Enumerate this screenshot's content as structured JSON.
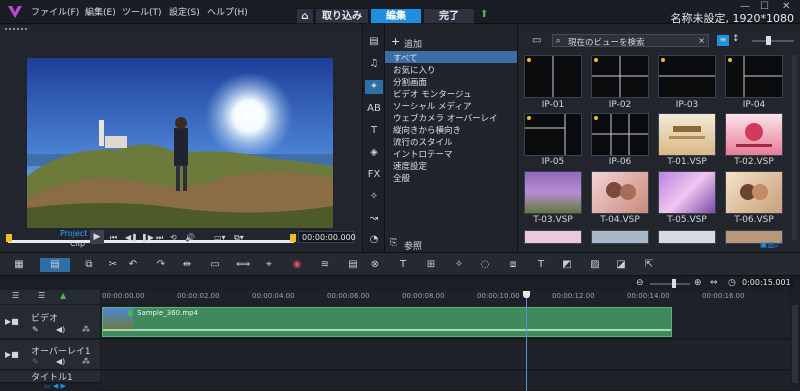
{
  "menu": [
    "ファイル(F)",
    "編集(E)",
    "ツール(T)",
    "設定(S)",
    "ヘルプ(H)"
  ],
  "nav_tabs": [
    {
      "label": "取り込み"
    },
    {
      "label": "編集",
      "active": true
    },
    {
      "label": "完了"
    }
  ],
  "project_title": "名称未設定, 1920*1080",
  "player": {
    "project_label": "Project",
    "clip_label": "Clip",
    "timecode": "00:00:00.000",
    "brackets": "[   ]"
  },
  "library": {
    "add_label": "追加",
    "categories": [
      "すべて",
      "お気に入り",
      "分割画面",
      "ビデオ モンタージュ",
      "ソーシャル メディア",
      "ウェブカメラ オーバーレイ",
      "縦向きから横向き",
      "流行のスタイル",
      "イントロテーマ",
      "速度設定",
      "全般"
    ],
    "browse_label": "参照",
    "search_placeholder": "現在のビューを検索",
    "thumbnails": [
      {
        "label": "IP-01"
      },
      {
        "label": "IP-02"
      },
      {
        "label": "IP-03"
      },
      {
        "label": "IP-04"
      },
      {
        "label": "IP-05"
      },
      {
        "label": "IP-06"
      },
      {
        "label": "T-01.VSP"
      },
      {
        "label": "T-02.VSP"
      },
      {
        "label": "T-03.VSP"
      },
      {
        "label": "T-04.VSP"
      },
      {
        "label": "T-05.VSP"
      },
      {
        "label": "T-06.VSP"
      }
    ]
  },
  "timeline": {
    "timecode": "0:00:15.001",
    "ruler": [
      "00:00:00.00",
      "00:00:02.00",
      "00:00:04.00",
      "00:00:06.00",
      "00:00:08.00",
      "00:00:10.00",
      "00:00:12.00",
      "00:00:14.00",
      "00:00:16.00"
    ],
    "tracks": [
      {
        "name": "ビデオ"
      },
      {
        "name": "オーバーレイ1"
      },
      {
        "name": "タイトル1"
      }
    ],
    "clip_name": "Sample_360.mp4",
    "playhead_fraction": 0.617
  },
  "colors": {
    "accent": "#1f8fe0",
    "clip": "#3e8a5c",
    "playhead": "#5a8fd6"
  }
}
